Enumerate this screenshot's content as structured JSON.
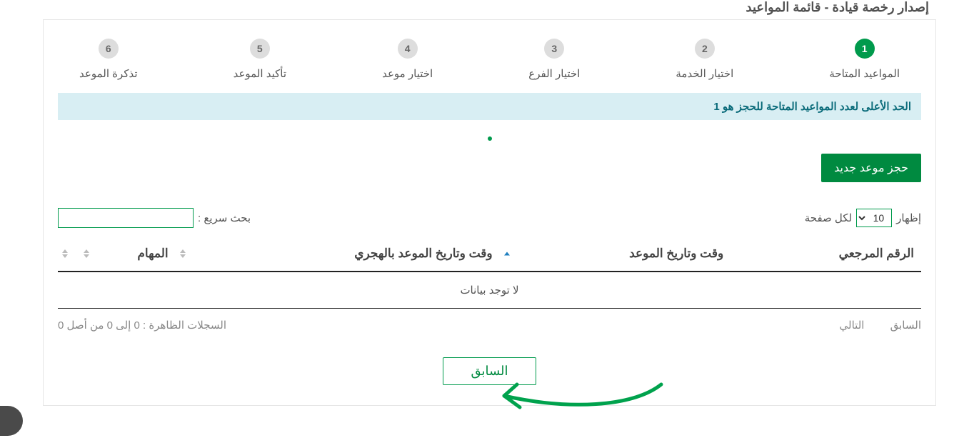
{
  "pageTitle": "إصدار رخصة قيادة - قائمة المواعيد",
  "stepper": [
    {
      "num": "1",
      "label": "المواعيد المتاحة",
      "active": true
    },
    {
      "num": "2",
      "label": "اختيار الخدمة",
      "active": false
    },
    {
      "num": "3",
      "label": "اختيار الفرع",
      "active": false
    },
    {
      "num": "4",
      "label": "اختيار موعد",
      "active": false
    },
    {
      "num": "5",
      "label": "تأكيد الموعد",
      "active": false
    },
    {
      "num": "6",
      "label": "تذكرة الموعد",
      "active": false
    }
  ],
  "alertText": "الحد الأعلى لعدد المواعيد المتاحة للحجز هو 1",
  "newBookingLabel": "حجز موعد جديد",
  "length": {
    "prefix": "إظهار",
    "suffix": "لكل صفحة",
    "options": [
      "10"
    ],
    "selected": "10"
  },
  "search": {
    "label": "بحث سريع :"
  },
  "columns": {
    "ref": "الرقم المرجعي",
    "date": "وقت وتاريخ الموعد",
    "hijri": "وقت وتاريخ الموعد بالهجري",
    "actions": "المهام"
  },
  "emptyText": "لا توجد بيانات",
  "pager": {
    "prev": "السابق",
    "next": "التالي"
  },
  "recordsInfo": "السجلات الظاهرة : 0 إلى 0 من أصل 0",
  "backLabel": "السابق"
}
